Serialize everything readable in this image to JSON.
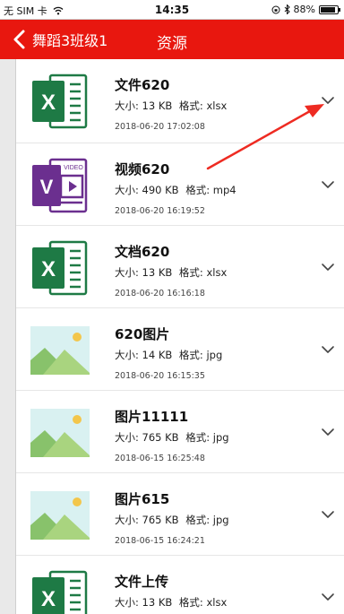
{
  "status_bar": {
    "carrier": "无 SIM 卡",
    "wifi_icon": "wifi-icon",
    "time": "14:35",
    "lock_icon": "lock-rotation-icon",
    "bluetooth_icon": "bluetooth-icon",
    "battery_percent": "88%",
    "battery_level": 0.88
  },
  "nav": {
    "back_label": "舞蹈3班级1",
    "title": "资源",
    "accent_color": "#e8170f"
  },
  "files": [
    {
      "name": "文件620",
      "size_label": "大小:",
      "size": "13 KB",
      "format_label": "格式:",
      "format": "xlsx",
      "date": "2018-06-20 17:02:08",
      "icon": "excel-file-icon"
    },
    {
      "name": "视频620",
      "size_label": "大小:",
      "size": "490 KB",
      "format_label": "格式:",
      "format": "mp4",
      "date": "2018-06-20 16:19:52",
      "icon": "video-file-icon",
      "icon_caption": "VIDEO"
    },
    {
      "name": "文档620",
      "size_label": "大小:",
      "size": "13 KB",
      "format_label": "格式:",
      "format": "xlsx",
      "date": "2018-06-20 16:16:18",
      "icon": "excel-file-icon"
    },
    {
      "name": "620图片",
      "size_label": "大小:",
      "size": "14 KB",
      "format_label": "格式:",
      "format": "jpg",
      "date": "2018-06-20 16:15:35",
      "icon": "image-file-icon"
    },
    {
      "name": "图片11111",
      "size_label": "大小:",
      "size": "765 KB",
      "format_label": "格式:",
      "format": "jpg",
      "date": "2018-06-15 16:25:48",
      "icon": "image-file-icon"
    },
    {
      "name": "图片615",
      "size_label": "大小:",
      "size": "765 KB",
      "format_label": "格式:",
      "format": "jpg",
      "date": "2018-06-15 16:24:21",
      "icon": "image-file-icon"
    },
    {
      "name": "文件上传",
      "size_label": "大小:",
      "size": "13 KB",
      "format_label": "格式:",
      "format": "xlsx",
      "date": "",
      "icon": "excel-file-icon"
    }
  ],
  "excel_letter": "X",
  "video_letter": "V",
  "annotation_color": "#ee2b22"
}
